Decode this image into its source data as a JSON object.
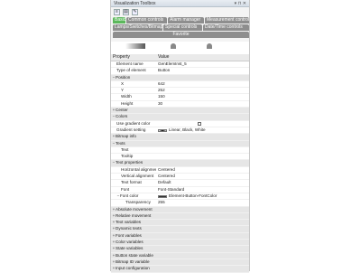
{
  "window": {
    "title": "Visualization Toolbox",
    "pin": "▾ ⊓ ✕"
  },
  "toolbar": {
    "icons": [
      "≡",
      "▤",
      "✎"
    ]
  },
  "tabs": [
    {
      "label": "Basic",
      "active": true
    },
    {
      "label": "Common controls",
      "active": false
    },
    {
      "label": "Alarm manager",
      "active": false
    },
    {
      "label": "Measurement controls",
      "active": false
    },
    {
      "label": "Lamps/Switches/Bitmaps",
      "active": false
    },
    {
      "label": "Special controls",
      "active": false
    },
    {
      "label": "Date/Time controls",
      "active": false
    },
    {
      "label": "Favorite",
      "active": false
    }
  ],
  "grid": {
    "headers": [
      "Property",
      "Value"
    ],
    "rows": [
      {
        "name": "Element name",
        "value": "GenElemInst_5",
        "level": 1
      },
      {
        "name": "Type of element",
        "value": "Button",
        "level": 1
      },
      {
        "name": "Position",
        "value": "",
        "level": 0,
        "toggle": "−",
        "group": true
      },
      {
        "name": "X",
        "value": "642",
        "level": 2
      },
      {
        "name": "Y",
        "value": "252",
        "level": 2
      },
      {
        "name": "Width",
        "value": "150",
        "level": 2
      },
      {
        "name": "Height",
        "value": "30",
        "level": 2
      },
      {
        "name": "Center",
        "value": "",
        "level": 0,
        "toggle": "+",
        "group": true
      },
      {
        "name": "Colors",
        "value": "",
        "level": 0,
        "toggle": "−",
        "group": true
      },
      {
        "name": "Use gradient color",
        "value": "",
        "level": 1,
        "checkbox": true
      },
      {
        "name": "Gradient setting",
        "value": "Linear, Black, White",
        "level": 1,
        "swatch": "grad"
      },
      {
        "name": "Bitmap info",
        "value": "",
        "level": 0,
        "toggle": "+",
        "group": true
      },
      {
        "name": "Texts",
        "value": "",
        "level": 0,
        "toggle": "−",
        "group": true
      },
      {
        "name": "Text",
        "value": "",
        "level": 2
      },
      {
        "name": "Tooltip",
        "value": "",
        "level": 2
      },
      {
        "name": "Text properties",
        "value": "",
        "level": 0,
        "toggle": "−",
        "group": true
      },
      {
        "name": "Horizontal alignment",
        "value": "Centered",
        "level": 2
      },
      {
        "name": "Vertical alignment",
        "value": "Centered",
        "level": 2
      },
      {
        "name": "Text format",
        "value": "Default",
        "level": 2
      },
      {
        "name": "Font",
        "value": "Font-Standard",
        "level": 2
      },
      {
        "name": "Font color",
        "value": "Element-Button-FontColor",
        "level": 1,
        "toggle": "−",
        "swatch": "dark"
      },
      {
        "name": "Transparency",
        "value": "255",
        "level": 3
      },
      {
        "name": "Absolute movement",
        "value": "",
        "level": 0,
        "toggle": "+",
        "group": true
      },
      {
        "name": "Relative movement",
        "value": "",
        "level": 0,
        "toggle": "+",
        "group": true
      },
      {
        "name": "Text variables",
        "value": "",
        "level": 0,
        "toggle": "+",
        "group": true
      },
      {
        "name": "Dynamic texts",
        "value": "",
        "level": 0,
        "toggle": "+",
        "group": true
      },
      {
        "name": "Font variables",
        "value": "",
        "level": 0,
        "toggle": "+",
        "group": true
      },
      {
        "name": "Color variables",
        "value": "",
        "level": 0,
        "toggle": "+",
        "group": true
      },
      {
        "name": "State variables",
        "value": "",
        "level": 0,
        "toggle": "+",
        "group": true
      },
      {
        "name": "Button state variable",
        "value": "",
        "level": 0,
        "toggle": "+",
        "group": true
      },
      {
        "name": "Bitmap ID variable",
        "value": "",
        "level": 0,
        "toggle": "+",
        "group": true
      },
      {
        "name": "Input configuration",
        "value": "",
        "level": 0,
        "toggle": "+",
        "group": true
      }
    ]
  }
}
